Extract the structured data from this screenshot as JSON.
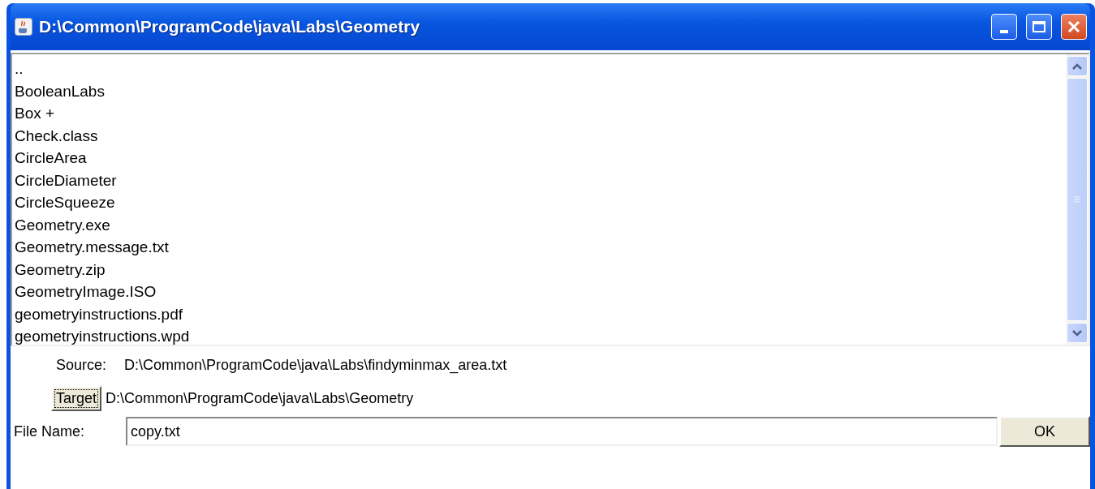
{
  "window": {
    "title": "D:\\Common\\ProgramCode\\java\\Labs\\Geometry"
  },
  "file_list": {
    "items": [
      {
        "name": ".."
      },
      {
        "name": "BooleanLabs"
      },
      {
        "name": "Box +"
      },
      {
        "name": "Check.class"
      },
      {
        "name": "CircleArea"
      },
      {
        "name": "CircleDiameter"
      },
      {
        "name": "CircleSqueeze"
      },
      {
        "name": "Geometry.exe"
      },
      {
        "name": "Geometry.message.txt"
      },
      {
        "name": "Geometry.zip"
      },
      {
        "name": "GeometryImage.ISO"
      },
      {
        "name": "geometryinstructions.pdf"
      },
      {
        "name": "geometryinstructions.wpd"
      }
    ]
  },
  "source": {
    "label": "Source:",
    "value": "D:\\Common\\ProgramCode\\java\\Labs\\findyminmax_area.txt"
  },
  "target": {
    "button": "Target",
    "value": "D:\\Common\\ProgramCode\\java\\Labs\\Geometry"
  },
  "file_name": {
    "label": "File Name:",
    "value": "copy.txt"
  },
  "buttons": [
    "OK"
  ]
}
